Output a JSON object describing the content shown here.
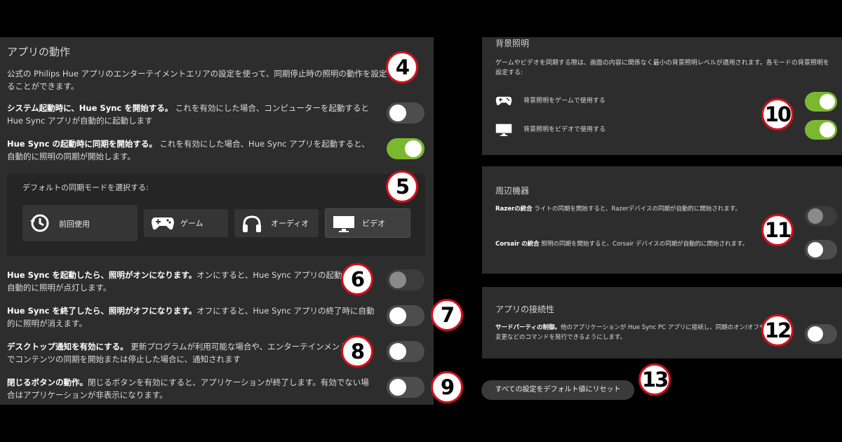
{
  "left": {
    "section_title": "アプリの動作",
    "entertainment": "公式の Philips Hue アプリのエンターテイメントエリアの設定を使って、同期停止時の照明の動作を設定することができます。",
    "rows": [
      {
        "title": "システム起動時に、Hue Sync を開始する。",
        "text": "これを有効にした場合、コンピューターを起動すると Hue Sync アプリが自動的に起動します",
        "state": "off"
      },
      {
        "title": "Hue Sync の起動時に同期を開始する。",
        "text": "これを有効にした場合、Hue Sync アプリを起動すると、自動的に照明の同期が開始します。",
        "state": "on"
      },
      {
        "title": "Hue Sync を起動したら、照明がオンになります。",
        "text": "オンにすると、Hue Sync アプリの起動時に自動的に照明が点灯します。",
        "state": "disabled"
      },
      {
        "title": "Hue Sync を終了したら、照明がオフになります。",
        "text": "オフにすると、Hue Sync アプリの終了時に自動的に照明が消えます。",
        "state": "off"
      },
      {
        "title": "デスクトップ通知を有効にする。",
        "text": "更新プログラムが利用可能な場合や、エンターテインメントエリアでコンテンツの同期を開始または停止した場合に、通知されます",
        "state": "off"
      },
      {
        "title": "閉じるボタンの動作。",
        "text": "閉じるボタンを有効にすると、アプリケーションが終了します。有効でない場合はアプリケーションが非表示になります。",
        "state": "off"
      }
    ],
    "default_mode": {
      "label": "デフォルトの同期モードを選択する:",
      "modes": [
        {
          "label": "前回使用",
          "icon": "history-icon"
        },
        {
          "label": "ゲーム",
          "icon": "gamepad-icon"
        },
        {
          "label": "オーディオ",
          "icon": "headphones-icon"
        },
        {
          "label": "ビデオ",
          "icon": "monitor-icon"
        }
      ],
      "selected": "ビデオ"
    }
  },
  "right": {
    "backlight": {
      "title": "背景照明",
      "text": "ゲームやビデオを同期する際は、画面の内容に関係なく最小の背景照明レベルが適用されます。各モードの背景照明を設定する:",
      "game_label": "背景照明をゲームで使用する",
      "video_label": "背景照明をビデオで使用する",
      "game_state": "on",
      "video_state": "on"
    },
    "peripherals": {
      "title": "周辺機器",
      "razer_title": "Razerの統合",
      "razer_text": "ライトの同期を開始すると、Razerデバイスの同期が自動的に開始されます。",
      "razer_state": "disabled",
      "corsair_title": "Corsair の統合",
      "corsair_text": "照明の同期を開始すると、Corsair デバイスの同期が自動的に開始されます。",
      "corsair_state": "off"
    },
    "connectivity": {
      "title": "アプリの接続性",
      "third_title": "サードパーティの制御。",
      "third_text": "他のアプリケーションが Hue Sync PC アプリに接続し、同期のオン/オフや明るさの変更などのコマンドを発行できるようにします。",
      "state": "off"
    },
    "reset_label": "すべての設定をデフォルト値にリセット"
  },
  "badges": [
    "4",
    "5",
    "6",
    "7",
    "8",
    "9",
    "10",
    "11",
    "12",
    "13"
  ],
  "colors": {
    "accent": "#7cb82f",
    "badge_border": "#d4101b",
    "panel": "#2d2d2d"
  }
}
